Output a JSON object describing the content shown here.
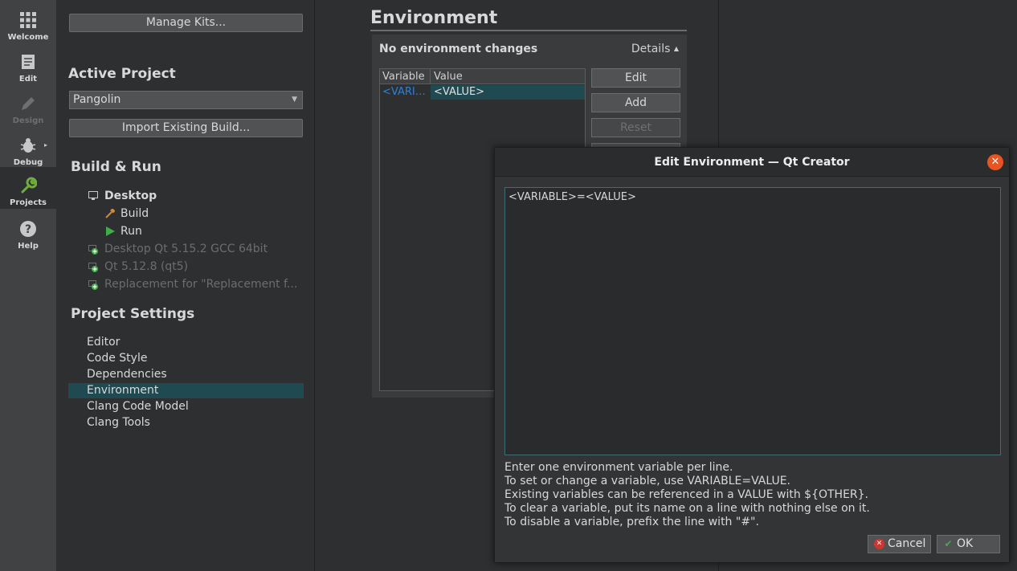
{
  "modebar": {
    "items": [
      {
        "label": "Welcome",
        "icon": "grid-icon",
        "state": "normal"
      },
      {
        "label": "Edit",
        "icon": "document-icon",
        "state": "normal"
      },
      {
        "label": "Design",
        "icon": "pencil-icon",
        "state": "disabled"
      },
      {
        "label": "Debug",
        "icon": "bug-icon",
        "state": "normal"
      },
      {
        "label": "Projects",
        "icon": "wrench-icon",
        "state": "active"
      },
      {
        "label": "Help",
        "icon": "help-icon",
        "state": "normal"
      }
    ]
  },
  "left": {
    "manage_kits": "Manage Kits...",
    "active_project_heading": "Active Project",
    "active_project": "Pangolin",
    "import_build": "Import Existing Build...",
    "build_run_heading": "Build & Run",
    "kit_desktop": "Desktop",
    "build": "Build",
    "run": "Run",
    "kits_inactive": [
      "Desktop Qt 5.15.2 GCC 64bit",
      "Qt 5.12.8 (qt5)",
      "Replacement for \"Replacement f..."
    ],
    "project_settings_heading": "Project Settings",
    "project_settings": [
      "Editor",
      "Code Style",
      "Dependencies",
      "Environment",
      "Clang Code Model",
      "Clang Tools"
    ],
    "selected_setting": "Environment"
  },
  "environment": {
    "title": "Environment",
    "summary": "No environment changes",
    "details": "Details",
    "table_headers": [
      "Variable",
      "Value"
    ],
    "rows": [
      {
        "variable": "<VARI…",
        "value": "<VALUE>"
      }
    ],
    "buttons": {
      "edit": "Edit",
      "add": "Add",
      "reset": "Reset"
    }
  },
  "dialog": {
    "title": "Edit Environment — Qt Creator",
    "editor_text": "<VARIABLE>=<VALUE>",
    "help_lines": [
      "Enter one environment variable per line.",
      "To set or change a variable, use VARIABLE=VALUE.",
      "Existing variables can be referenced in a VALUE with ${OTHER}.",
      "To clear a variable, put its name on a line with nothing else on it.",
      "To disable a variable, prefix the line with \"#\"."
    ],
    "cancel": "Cancel",
    "ok": "OK"
  },
  "colors": {
    "accent_selection": "#1f4a52",
    "run_green": "#3fae49",
    "close_orange": "#e95420",
    "link_blue": "#2a82da"
  }
}
